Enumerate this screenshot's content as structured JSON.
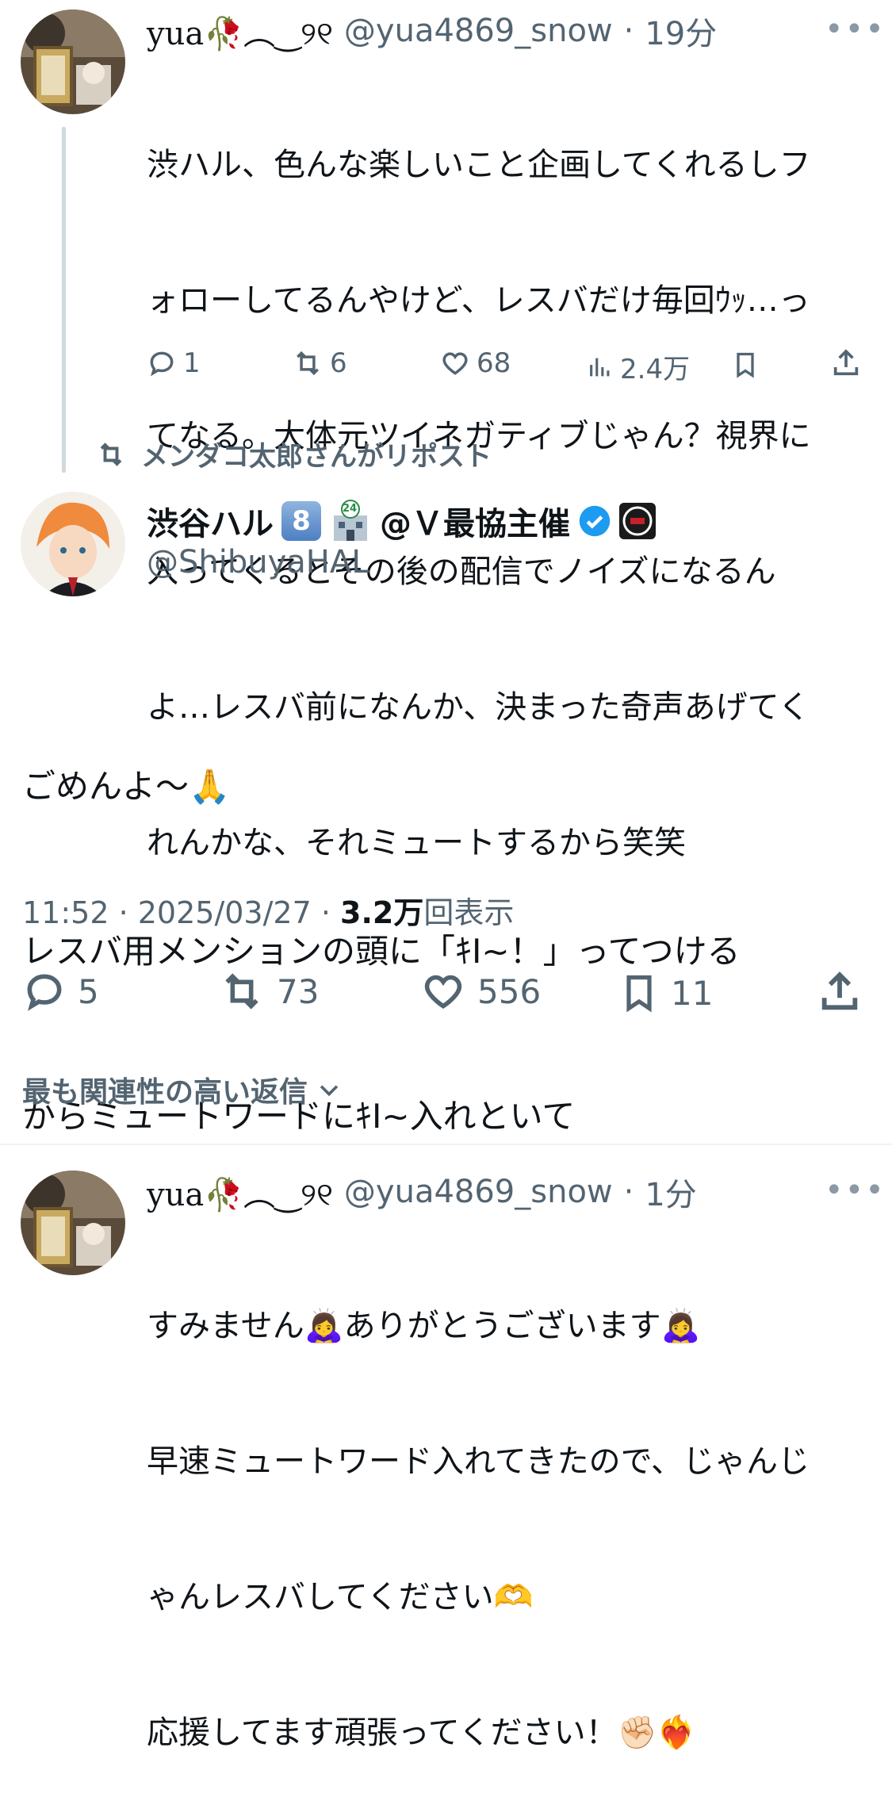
{
  "reply_tweet": {
    "name": "yua🥀︵‿୨୧",
    "handle": "@yua4869_snow",
    "separator": "·",
    "time": "19分",
    "more": "•••",
    "lines": [
      "渋ハル、色んな楽しいこと企画してくれるしフ",
      "ォローしてるんやけど、レスバだけ毎回ｳｯ…っ",
      "てなる。大体元ツイネガティブじゃん？視界に",
      "入ってくるとその後の配信でノイズになるん",
      "よ…レスバ前になんか、決まった奇声あげてく",
      "れんかな、それミュートするから笑笑"
    ],
    "stats": {
      "replies": "1",
      "reposts": "6",
      "likes": "68",
      "views": "2.4万"
    }
  },
  "repost_banner": "メンダコ太郎さんがリポスト",
  "main_tweet": {
    "name": "渋谷ハル",
    "name_suffix": "@Ｖ最協主催",
    "keycap": "8",
    "building_label": "24",
    "handle": "@ShibuyaHAL",
    "body_lines": [
      "ごめんよ〜🙏",
      "レスバ用メンションの頭に「ｷI~！」ってつける",
      "からミュートワードにｷI~入れといて"
    ],
    "timestamp": "11:52 · 2025/03/27 · ",
    "view_count": "3.2万",
    "view_label": "回表示",
    "stats": {
      "replies": "5",
      "reposts": "73",
      "likes": "556",
      "bookmarks": "11"
    }
  },
  "sort_label": "最も関連性の高い返信",
  "reply2": {
    "name": "yua🥀︵‿୨୧",
    "handle": "@yua4869_snow",
    "separator": "·",
    "time": "1分",
    "more": "•••",
    "lines": [
      "すみません🙇‍♀️ありがとうございます🙇‍♀️",
      "早速ミュートワード入れてきたので、じゃんじ",
      "ゃんレスバしてください🫶",
      "応援してます頑張ってください！✊🏻❤️‍🔥"
    ]
  },
  "colors": {
    "text": "#0f1419",
    "muted": "#536471",
    "verified": "#1d9bf0",
    "divider": "#eff3f4",
    "thread_line": "#cfd9de"
  }
}
